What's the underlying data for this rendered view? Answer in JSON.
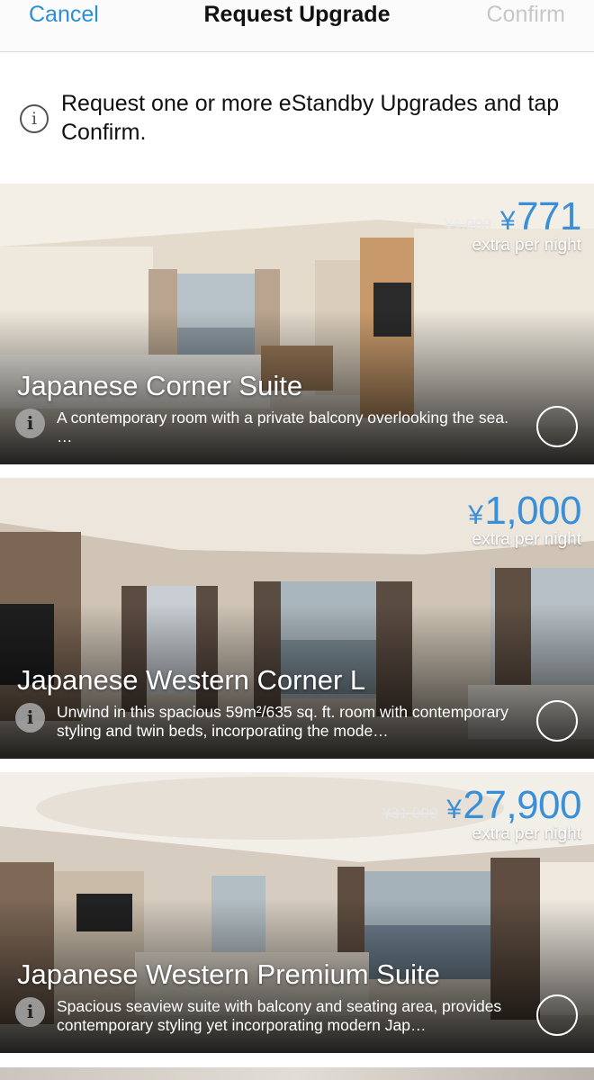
{
  "navbar": {
    "cancel_label": "Cancel",
    "title": "Request Upgrade",
    "confirm_label": "Confirm"
  },
  "banner": {
    "icon": "info-circle-icon",
    "text": "Request one or more eStandby Upgrades and tap Confirm."
  },
  "colors": {
    "accent": "#2c8fd6",
    "price": "#3a90d8",
    "disabled": "#c7c7c7"
  },
  "rooms": [
    {
      "name": "Japanese Corner Suite",
      "original_price": "¥1,000",
      "currency": "¥",
      "price": "771",
      "price_note": "extra per night",
      "description": "A contemporary room with a private balcony overlooking the sea. …"
    },
    {
      "name": "Japanese Western Corner L",
      "original_price": "",
      "currency": "¥",
      "price": "1,000",
      "price_note": "extra per night",
      "description": "Unwind in this spacious 59m²/635 sq. ft. room with contemporary styling and twin beds, incorporating the mode…"
    },
    {
      "name": "Japanese Western Premium Suite",
      "original_price": "¥31,000",
      "currency": "¥",
      "price": "27,900",
      "price_note": "extra per night",
      "description": "Spacious seaview suite with balcony and seating area, provides contemporary styling yet incorporating modern Jap…"
    }
  ]
}
